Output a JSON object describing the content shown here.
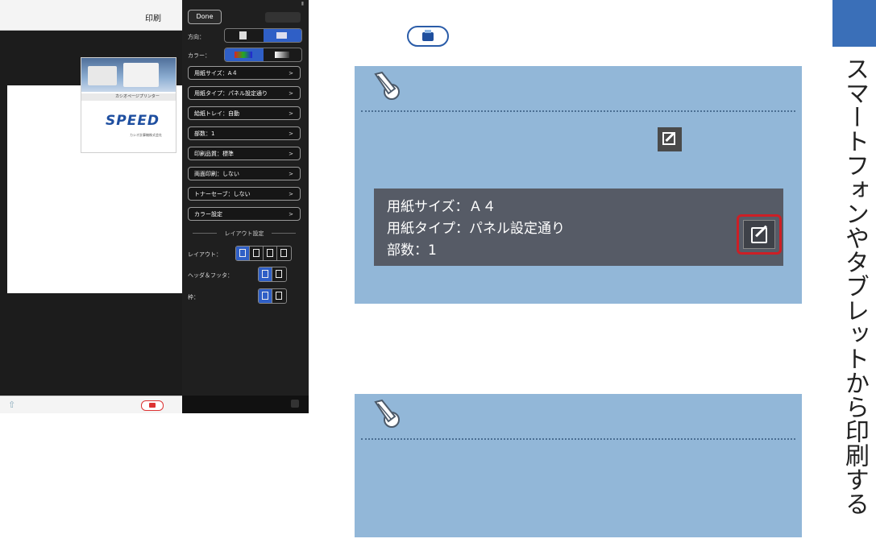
{
  "phone": {
    "preview_title": "印刷",
    "done_label": "Done",
    "orientation_label": "方向：",
    "color_label": "カラー：",
    "menu": [
      {
        "label": "用紙サイズ：A４",
        "chevron": ">"
      },
      {
        "label": "用紙タイプ：パネル設定通り",
        "chevron": ">"
      },
      {
        "label": "給紙トレイ：自動",
        "chevron": ">"
      },
      {
        "label": "部数：1",
        "chevron": ">"
      },
      {
        "label": "印刷品質：標準",
        "chevron": ">"
      },
      {
        "label": "両面印刷：しない",
        "chevron": ">"
      },
      {
        "label": "トナーセーブ：しない",
        "chevron": ">"
      },
      {
        "label": "カラー設定",
        "chevron": ">"
      }
    ],
    "layout_section_title": "レイアウト設定",
    "layout_label": "レイアウト：",
    "header_footer_label": "ヘッダ＆フッタ：",
    "frame_label": "枠：",
    "doc": {
      "bar_text": "カシオページプリンター",
      "logo": "SPEED",
      "footer": "カシオ計算機株式会社"
    }
  },
  "manual": {
    "settings_lines": [
      "用紙サイズ：Ａ４",
      "用紙タイプ：パネル設定通り",
      "部数：1"
    ]
  },
  "side_title": "スマートフォンやタブレットから印刷する",
  "colors": {
    "note_bg": "#92b7d8",
    "panel_bg": "#565b66",
    "highlight": "#cc1f26",
    "tab_blue": "#3a6fb8",
    "ios_blue": "#2f5fc6"
  }
}
